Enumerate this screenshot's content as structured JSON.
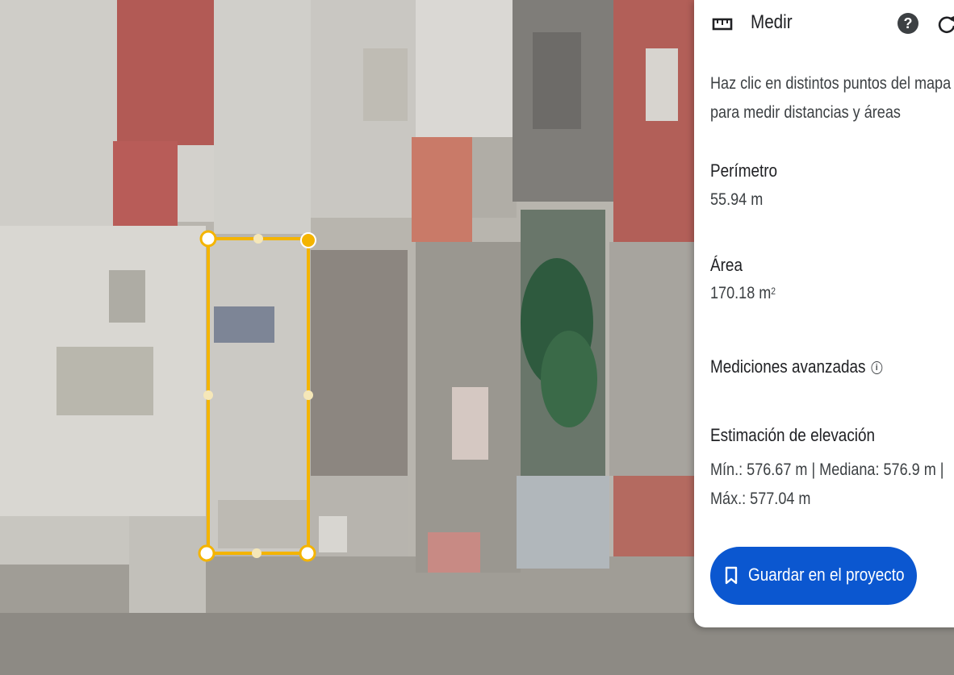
{
  "panel": {
    "title": "Medir",
    "ruler_icon": "ruler-icon",
    "help_icon": "help-icon",
    "help_glyph": "?",
    "reset_icon": "reset-icon",
    "instructions": "Haz clic en distintos puntos del mapa para medir distancias y áreas",
    "perimeter_label": "Perímetro",
    "perimeter_value": "55.94 m",
    "area_label": "Área",
    "area_value": "170.18 m",
    "area_unit_sup": "2",
    "advanced_label": "Mediciones avanzadas",
    "info_icon": "info-icon",
    "info_glyph": "i",
    "elevation_label": "Estimación de elevación",
    "elevation_value": "Mín.: 576.67 m | Mediana: 576.9 m | Máx.: 577.04 m",
    "save_button_label": "Guardar en el proyecto",
    "save_icon": "bookmark-icon",
    "colors": {
      "save_button": "#0b57d0",
      "measure_outline": "#f4b400"
    }
  },
  "map": {
    "type": "satellite",
    "measurement_shape": "rectangle"
  }
}
